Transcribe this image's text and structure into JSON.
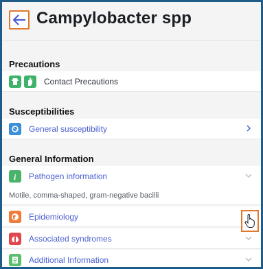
{
  "header": {
    "title": "Campylobacter spp",
    "back_icon": "arrow-left-icon"
  },
  "sections": {
    "precautions": {
      "title": "Precautions",
      "items": [
        {
          "label": "Contact Precautions",
          "icons": [
            "gown-icon",
            "glove-icon"
          ]
        }
      ]
    },
    "susceptibilities": {
      "title": "Susceptibilities",
      "items": [
        {
          "label": "General susceptibility",
          "icon": "bacteria-icon",
          "action_icon": "chevron-right-icon"
        }
      ]
    },
    "general_information": {
      "title": "General Information",
      "items": [
        {
          "label": "Pathogen information",
          "icon": "info-icon",
          "action_icon": "chevron-down-icon",
          "expanded_text": "Motile, comma-shaped, gram-negative bacilli"
        },
        {
          "label": "Epidemiology",
          "icon": "globe-icon",
          "action_icon": "chevron-down-icon"
        },
        {
          "label": "Associated syndromes",
          "icon": "lungs-icon",
          "action_icon": "chevron-down-icon"
        },
        {
          "label": "Additional Information",
          "icon": "document-icon",
          "action_icon": "chevron-down-icon"
        }
      ]
    }
  },
  "colors": {
    "accent": "#4a5fd1",
    "highlight": "#e07a2f",
    "precaution_green": "#3fb36b",
    "info_green": "#49b36a",
    "epi_orange": "#f07b3a",
    "syndrome_red": "#e0464b",
    "doc_green": "#5cbf6e",
    "bacteria_blue": "#3b8fd9"
  }
}
